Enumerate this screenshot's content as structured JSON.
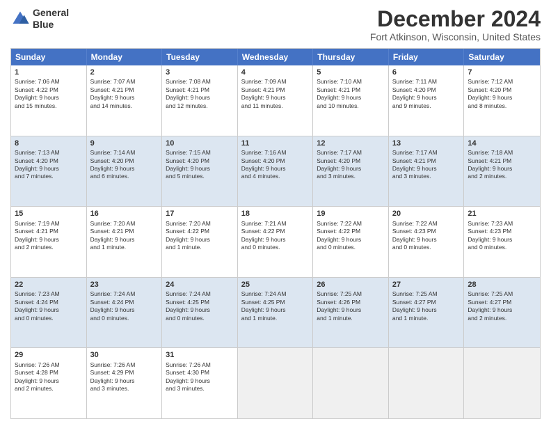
{
  "header": {
    "logo_line1": "General",
    "logo_line2": "Blue",
    "title": "December 2024",
    "subtitle": "Fort Atkinson, Wisconsin, United States"
  },
  "weekdays": [
    "Sunday",
    "Monday",
    "Tuesday",
    "Wednesday",
    "Thursday",
    "Friday",
    "Saturday"
  ],
  "weeks": [
    [
      {
        "num": "1",
        "lines": [
          "Sunrise: 7:06 AM",
          "Sunset: 4:22 PM",
          "Daylight: 9 hours",
          "and 15 minutes."
        ]
      },
      {
        "num": "2",
        "lines": [
          "Sunrise: 7:07 AM",
          "Sunset: 4:21 PM",
          "Daylight: 9 hours",
          "and 14 minutes."
        ]
      },
      {
        "num": "3",
        "lines": [
          "Sunrise: 7:08 AM",
          "Sunset: 4:21 PM",
          "Daylight: 9 hours",
          "and 12 minutes."
        ]
      },
      {
        "num": "4",
        "lines": [
          "Sunrise: 7:09 AM",
          "Sunset: 4:21 PM",
          "Daylight: 9 hours",
          "and 11 minutes."
        ]
      },
      {
        "num": "5",
        "lines": [
          "Sunrise: 7:10 AM",
          "Sunset: 4:21 PM",
          "Daylight: 9 hours",
          "and 10 minutes."
        ]
      },
      {
        "num": "6",
        "lines": [
          "Sunrise: 7:11 AM",
          "Sunset: 4:20 PM",
          "Daylight: 9 hours",
          "and 9 minutes."
        ]
      },
      {
        "num": "7",
        "lines": [
          "Sunrise: 7:12 AM",
          "Sunset: 4:20 PM",
          "Daylight: 9 hours",
          "and 8 minutes."
        ]
      }
    ],
    [
      {
        "num": "8",
        "lines": [
          "Sunrise: 7:13 AM",
          "Sunset: 4:20 PM",
          "Daylight: 9 hours",
          "and 7 minutes."
        ]
      },
      {
        "num": "9",
        "lines": [
          "Sunrise: 7:14 AM",
          "Sunset: 4:20 PM",
          "Daylight: 9 hours",
          "and 6 minutes."
        ]
      },
      {
        "num": "10",
        "lines": [
          "Sunrise: 7:15 AM",
          "Sunset: 4:20 PM",
          "Daylight: 9 hours",
          "and 5 minutes."
        ]
      },
      {
        "num": "11",
        "lines": [
          "Sunrise: 7:16 AM",
          "Sunset: 4:20 PM",
          "Daylight: 9 hours",
          "and 4 minutes."
        ]
      },
      {
        "num": "12",
        "lines": [
          "Sunrise: 7:17 AM",
          "Sunset: 4:20 PM",
          "Daylight: 9 hours",
          "and 3 minutes."
        ]
      },
      {
        "num": "13",
        "lines": [
          "Sunrise: 7:17 AM",
          "Sunset: 4:21 PM",
          "Daylight: 9 hours",
          "and 3 minutes."
        ]
      },
      {
        "num": "14",
        "lines": [
          "Sunrise: 7:18 AM",
          "Sunset: 4:21 PM",
          "Daylight: 9 hours",
          "and 2 minutes."
        ]
      }
    ],
    [
      {
        "num": "15",
        "lines": [
          "Sunrise: 7:19 AM",
          "Sunset: 4:21 PM",
          "Daylight: 9 hours",
          "and 2 minutes."
        ]
      },
      {
        "num": "16",
        "lines": [
          "Sunrise: 7:20 AM",
          "Sunset: 4:21 PM",
          "Daylight: 9 hours",
          "and 1 minute."
        ]
      },
      {
        "num": "17",
        "lines": [
          "Sunrise: 7:20 AM",
          "Sunset: 4:22 PM",
          "Daylight: 9 hours",
          "and 1 minute."
        ]
      },
      {
        "num": "18",
        "lines": [
          "Sunrise: 7:21 AM",
          "Sunset: 4:22 PM",
          "Daylight: 9 hours",
          "and 0 minutes."
        ]
      },
      {
        "num": "19",
        "lines": [
          "Sunrise: 7:22 AM",
          "Sunset: 4:22 PM",
          "Daylight: 9 hours",
          "and 0 minutes."
        ]
      },
      {
        "num": "20",
        "lines": [
          "Sunrise: 7:22 AM",
          "Sunset: 4:23 PM",
          "Daylight: 9 hours",
          "and 0 minutes."
        ]
      },
      {
        "num": "21",
        "lines": [
          "Sunrise: 7:23 AM",
          "Sunset: 4:23 PM",
          "Daylight: 9 hours",
          "and 0 minutes."
        ]
      }
    ],
    [
      {
        "num": "22",
        "lines": [
          "Sunrise: 7:23 AM",
          "Sunset: 4:24 PM",
          "Daylight: 9 hours",
          "and 0 minutes."
        ]
      },
      {
        "num": "23",
        "lines": [
          "Sunrise: 7:24 AM",
          "Sunset: 4:24 PM",
          "Daylight: 9 hours",
          "and 0 minutes."
        ]
      },
      {
        "num": "24",
        "lines": [
          "Sunrise: 7:24 AM",
          "Sunset: 4:25 PM",
          "Daylight: 9 hours",
          "and 0 minutes."
        ]
      },
      {
        "num": "25",
        "lines": [
          "Sunrise: 7:24 AM",
          "Sunset: 4:25 PM",
          "Daylight: 9 hours",
          "and 1 minute."
        ]
      },
      {
        "num": "26",
        "lines": [
          "Sunrise: 7:25 AM",
          "Sunset: 4:26 PM",
          "Daylight: 9 hours",
          "and 1 minute."
        ]
      },
      {
        "num": "27",
        "lines": [
          "Sunrise: 7:25 AM",
          "Sunset: 4:27 PM",
          "Daylight: 9 hours",
          "and 1 minute."
        ]
      },
      {
        "num": "28",
        "lines": [
          "Sunrise: 7:25 AM",
          "Sunset: 4:27 PM",
          "Daylight: 9 hours",
          "and 2 minutes."
        ]
      }
    ],
    [
      {
        "num": "29",
        "lines": [
          "Sunrise: 7:26 AM",
          "Sunset: 4:28 PM",
          "Daylight: 9 hours",
          "and 2 minutes."
        ]
      },
      {
        "num": "30",
        "lines": [
          "Sunrise: 7:26 AM",
          "Sunset: 4:29 PM",
          "Daylight: 9 hours",
          "and 3 minutes."
        ]
      },
      {
        "num": "31",
        "lines": [
          "Sunrise: 7:26 AM",
          "Sunset: 4:30 PM",
          "Daylight: 9 hours",
          "and 3 minutes."
        ]
      },
      null,
      null,
      null,
      null
    ]
  ]
}
